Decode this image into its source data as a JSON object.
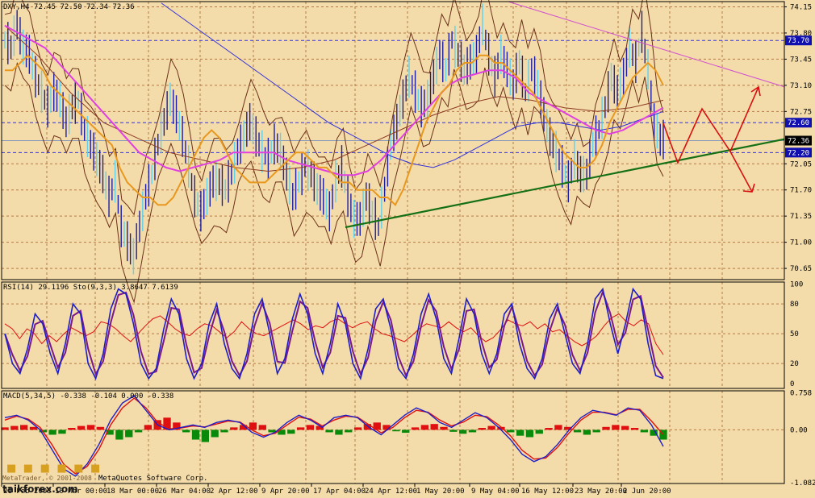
{
  "colors": {
    "background": "#f4dcaa",
    "grid": "#b07b48",
    "bars": "#1c1fa6",
    "bars_light": "#5fd0ee",
    "ma_orange": "#e8981e",
    "ma_magenta": "#e040e0",
    "ma_blue": "#3232d8",
    "ma_brown": "#8b3b24",
    "bollinger": "#6a3018",
    "trend_green": "#157015",
    "trend_magenta": "#d050d0",
    "arrow_red": "#d81010",
    "rsi_red": "#e01010",
    "stoch_blue": "#1e1ec8",
    "stoch_purple": "#7a1a8a",
    "macd_pos": "#e01010",
    "macd_neg": "#0a8a0a",
    "label_blue": "#1010b0",
    "label_black": "#000000"
  },
  "chart_data": [
    {
      "type": "line",
      "panel": "price",
      "title": "DXY,H4 72.45 72.50 72.34 72.36",
      "y_ticks": [
        "74.15",
        "73.80",
        "73.45",
        "73.10",
        "72.75",
        "72.05",
        "71.70",
        "71.35",
        "71.00",
        "70.65"
      ],
      "ylim": [
        70.5,
        74.22
      ],
      "price_labels": [
        {
          "value": 73.7,
          "text": "73.70",
          "style": "blue"
        },
        {
          "value": 72.6,
          "text": "72.60",
          "style": "blue"
        },
        {
          "value": 72.36,
          "text": "72.36",
          "style": "black"
        },
        {
          "value": 72.2,
          "text": "72.20",
          "style": "blue"
        }
      ],
      "reference_lines": [
        73.7,
        72.6,
        72.2
      ],
      "current_price": 72.36,
      "close_series": [
        73.7,
        73.6,
        73.9,
        73.6,
        73.5,
        73.2,
        73.0,
        72.8,
        73.0,
        72.9,
        72.6,
        72.8,
        72.9,
        72.5,
        72.3,
        72.1,
        71.9,
        71.6,
        71.8,
        71.2,
        71.0,
        70.8,
        71.2,
        71.6,
        71.9,
        72.3,
        72.6,
        72.9,
        72.7,
        72.4,
        72.0,
        71.6,
        71.4,
        71.6,
        71.8,
        71.8,
        71.7,
        71.9,
        72.2,
        72.4,
        72.6,
        72.4,
        72.2,
        72.1,
        72.3,
        72.2,
        71.9,
        71.6,
        71.8,
        72.0,
        71.9,
        71.7,
        71.6,
        71.4,
        71.8,
        72.0,
        71.6,
        71.3,
        71.3,
        71.6,
        71.4,
        71.2,
        71.7,
        72.3,
        72.6,
        72.9,
        73.2,
        73.0,
        72.8,
        72.9,
        73.2,
        73.5,
        73.3,
        73.7,
        73.5,
        73.3,
        73.4,
        73.5,
        73.9,
        73.5,
        73.2,
        73.5,
        73.3,
        73.1,
        73.4,
        73.0,
        73.3,
        73.1,
        72.7,
        72.4,
        72.2,
        72.0,
        71.8,
        72.1,
        71.9,
        71.9,
        72.3,
        72.5,
        72.8,
        73.2,
        73.0,
        73.2,
        73.6,
        73.4,
        73.8,
        73.3,
        72.6,
        72.36
      ],
      "ma_orange": [
        73.3,
        73.3,
        73.4,
        73.5,
        73.4,
        73.3,
        73.1,
        73.0,
        72.9,
        72.8,
        72.7,
        72.6,
        72.5,
        72.4,
        72.3,
        72.0,
        71.8,
        71.7,
        71.6,
        71.6,
        71.5,
        71.5,
        71.6,
        71.8,
        72.0,
        72.2,
        72.4,
        72.5,
        72.4,
        72.2,
        72.0,
        71.9,
        71.8,
        71.8,
        71.8,
        71.9,
        72.0,
        72.1,
        72.2,
        72.2,
        72.1,
        72.0,
        72.0,
        71.9,
        71.8,
        71.8,
        71.7,
        71.7,
        71.7,
        71.6,
        71.6,
        71.5,
        71.7,
        72.0,
        72.3,
        72.6,
        72.8,
        73.0,
        73.1,
        73.3,
        73.4,
        73.4,
        73.5,
        73.5,
        73.4,
        73.4,
        73.3,
        73.2,
        73.1,
        73.0,
        72.8,
        72.6,
        72.4,
        72.2,
        72.1,
        72.0,
        72.0,
        72.1,
        72.3,
        72.6,
        72.8,
        73.0,
        73.2,
        73.3,
        73.4,
        73.3,
        73.1
      ],
      "ma_magenta": [
        73.9,
        73.8,
        73.7,
        73.6,
        73.4,
        73.2,
        73.0,
        72.8,
        72.6,
        72.4,
        72.2,
        72.1,
        72.0,
        71.95,
        72.0,
        72.05,
        72.1,
        72.2,
        72.2,
        72.2,
        72.2,
        72.1,
        72.05,
        72.0,
        71.95,
        71.9,
        71.9,
        71.95,
        72.1,
        72.3,
        72.5,
        72.7,
        72.9,
        73.1,
        73.2,
        73.25,
        73.3,
        73.3,
        73.2,
        73.0,
        72.9,
        72.8,
        72.7,
        72.6,
        72.5,
        72.45,
        72.5,
        72.6,
        72.7,
        72.8
      ],
      "ma_blue": [
        74.2,
        74.0,
        73.8,
        73.6,
        73.4,
        73.2,
        73.0,
        72.8,
        72.6,
        72.45,
        72.3,
        72.15,
        72.05,
        72.0,
        72.1,
        72.25,
        72.4,
        72.55,
        72.6,
        72.6,
        72.55,
        72.5,
        72.55,
        72.65,
        72.75
      ],
      "ma_brown": [
        73.9,
        73.5,
        73.0,
        72.6,
        72.4,
        72.2,
        72.1,
        72.0,
        71.95,
        72.0,
        72.1,
        72.3,
        72.5,
        72.7,
        72.85,
        72.95,
        72.9,
        72.8,
        72.75,
        72.8,
        72.9
      ]
    },
    {
      "type": "line",
      "panel": "rsi_stoch",
      "title": "RSI(14) 29.1196 Sto(9,3,3) 3.8647 7.6139",
      "y_ticks": [
        "100",
        "80",
        "50",
        "20",
        "0"
      ],
      "ylim": [
        -5,
        102
      ],
      "rsi": [
        60,
        55,
        45,
        55,
        50,
        40,
        48,
        42,
        50,
        56,
        52,
        48,
        52,
        62,
        60,
        55,
        48,
        42,
        50,
        58,
        65,
        68,
        62,
        55,
        50,
        48,
        55,
        60,
        58,
        52,
        46,
        52,
        62,
        55,
        50,
        48,
        52,
        56,
        60,
        64,
        60,
        54,
        58,
        56,
        62,
        65,
        60,
        56,
        60,
        62,
        55,
        50,
        48,
        45,
        42,
        48,
        55,
        60,
        58,
        56,
        62,
        56,
        52,
        56,
        48,
        42,
        46,
        54,
        64,
        60,
        58,
        62,
        55,
        60,
        52,
        54,
        48,
        42,
        38,
        42,
        48,
        58,
        66,
        70,
        62,
        58,
        64,
        60,
        40,
        29
      ],
      "stoch": [
        50,
        20,
        10,
        35,
        70,
        60,
        30,
        10,
        40,
        80,
        70,
        20,
        5,
        30,
        75,
        95,
        90,
        60,
        20,
        5,
        15,
        55,
        85,
        70,
        25,
        5,
        20,
        60,
        80,
        40,
        15,
        5,
        30,
        70,
        85,
        50,
        10,
        25,
        65,
        90,
        70,
        30,
        10,
        40,
        80,
        60,
        20,
        5,
        35,
        75,
        85,
        55,
        15,
        5,
        30,
        70,
        90,
        65,
        25,
        10,
        45,
        85,
        70,
        30,
        10,
        30,
        70,
        80,
        40,
        15,
        5,
        25,
        65,
        80,
        50,
        20,
        10,
        40,
        85,
        95,
        60,
        30,
        60,
        95,
        85,
        40,
        8,
        5
      ]
    },
    {
      "type": "bar",
      "panel": "macd",
      "title": "MACD(5,34,5) -0.338 -0.104 0.000 -0.338",
      "y_ticks": [
        "0.758",
        "0.00",
        "-1.082"
      ],
      "ylim": [
        -1.1,
        0.8
      ],
      "histogram": [
        0.05,
        0.08,
        0.1,
        0.06,
        -0.05,
        -0.1,
        -0.08,
        0.04,
        0.08,
        0.1,
        0.06,
        -0.1,
        -0.2,
        -0.15,
        -0.05,
        0.1,
        0.2,
        0.25,
        0.15,
        -0.05,
        -0.2,
        -0.25,
        -0.15,
        -0.05,
        0.05,
        0.1,
        0.15,
        0.1,
        -0.05,
        -0.1,
        -0.08,
        0.05,
        0.1,
        0.08,
        -0.05,
        -0.1,
        -0.05,
        0.05,
        0.12,
        0.15,
        0.1,
        -0.03,
        -0.06,
        0.05,
        0.1,
        0.12,
        0.06,
        -0.04,
        -0.08,
        -0.05,
        0.04,
        0.08,
        0.06,
        -0.05,
        -0.12,
        -0.15,
        -0.08,
        0.04,
        0.1,
        0.06,
        -0.05,
        -0.1,
        -0.05,
        0.06,
        0.1,
        0.08,
        0.04,
        -0.05,
        -0.12,
        -0.2
      ],
      "macd_line": [
        0.25,
        0.3,
        0.2,
        0.0,
        -0.4,
        -0.8,
        -0.95,
        -0.7,
        -0.3,
        0.2,
        0.55,
        0.7,
        0.4,
        0.1,
        0.0,
        0.05,
        0.1,
        0.05,
        0.15,
        0.2,
        0.15,
        -0.05,
        -0.15,
        -0.05,
        0.15,
        0.3,
        0.2,
        0.05,
        0.25,
        0.3,
        0.25,
        0.05,
        -0.1,
        0.1,
        0.3,
        0.45,
        0.35,
        0.15,
        0.05,
        0.2,
        0.35,
        0.25,
        0.05,
        -0.2,
        -0.5,
        -0.65,
        -0.55,
        -0.3,
        0.0,
        0.25,
        0.4,
        0.35,
        0.3,
        0.45,
        0.4,
        0.1,
        -0.34
      ],
      "signal_line": [
        0.2,
        0.28,
        0.22,
        0.05,
        -0.3,
        -0.7,
        -0.9,
        -0.75,
        -0.4,
        0.1,
        0.45,
        0.65,
        0.45,
        0.15,
        0.02,
        0.04,
        0.08,
        0.06,
        0.12,
        0.18,
        0.16,
        0.0,
        -0.12,
        -0.07,
        0.1,
        0.26,
        0.22,
        0.08,
        0.2,
        0.28,
        0.26,
        0.1,
        -0.06,
        0.05,
        0.25,
        0.4,
        0.36,
        0.2,
        0.08,
        0.16,
        0.3,
        0.27,
        0.1,
        -0.12,
        -0.42,
        -0.6,
        -0.58,
        -0.36,
        -0.06,
        0.2,
        0.36,
        0.36,
        0.31,
        0.42,
        0.42,
        0.18,
        -0.1
      ]
    }
  ],
  "x_axis_labels": [
    "21 Feb 2008",
    "10 Mar 00:00",
    "18 Mar 00:00",
    "26 Mar 04:00",
    "2 Apr 12:00",
    "9 Apr 20:00",
    "17 Apr 04:00",
    "24 Apr 12:00",
    "1 May 20:00",
    "9 May 04:00",
    "16 May 12:00",
    "23 May 20:00",
    "2 Jun 20:00"
  ],
  "copyright": "MetaQuotes Software Corp.",
  "copyright_prefix": "MetaTrader, © 2001-2008",
  "watermark": {
    "logo_text": "taikforex.com"
  }
}
